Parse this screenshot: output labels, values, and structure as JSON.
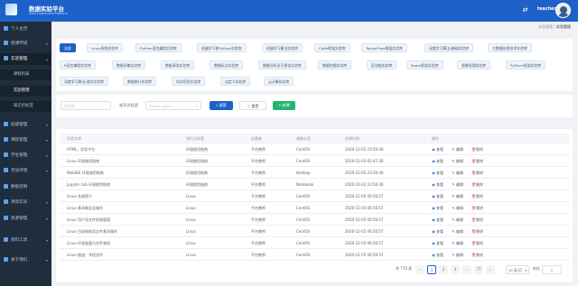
{
  "header": {
    "logo_icon": "platform-logo-icon",
    "title": "数据实验平台",
    "subtitle": "Data Experiment Platform",
    "user_name": "teacher",
    "icons": [
      "share-icon",
      "fullscreen-icon"
    ]
  },
  "sidebar": {
    "items": [
      {
        "label": "个人主页",
        "icon": "home-icon"
      },
      {
        "label": "授课环境",
        "icon": "desktop-icon"
      },
      {
        "label": "实验管理",
        "icon": "flask-icon"
      },
      {
        "label": "课程列表"
      },
      {
        "label": "实验管理"
      },
      {
        "label": "知识点标签"
      },
      {
        "label": "班级管理",
        "icon": "class-icon"
      },
      {
        "label": "课程管理",
        "icon": "book-icon"
      },
      {
        "label": "学生管理",
        "icon": "student-icon"
      },
      {
        "label": "考试评测",
        "icon": "exam-icon"
      },
      {
        "label": "数据控制",
        "icon": "data-icon"
      },
      {
        "label": "项目实训",
        "icon": "project-icon"
      },
      {
        "label": "资源管理",
        "icon": "resource-icon"
      },
      {
        "label": "资料工具",
        "icon": "tool-icon"
      },
      {
        "label": "关于我们",
        "icon": "info-icon"
      }
    ]
  },
  "breadcrumb": {
    "items": [
      "实验管理",
      "实验管理"
    ],
    "separator": "/"
  },
  "tags": {
    "items": [
      "全部",
      "Linux系统实验库",
      "Python语言编程实验库",
      "机器学习和Python实验库",
      "机器学习算法实验库",
      "Caffe框架实验库",
      "TensorFlow框架实验库",
      "深度学习算法/基础实验库",
      "大数据处理技术实验库",
      "R语言编程实验库",
      "数据采集实验库",
      "数据清洗实验库",
      "数据标注实验库",
      "数据分析及可视化实验库",
      "数据挖掘实验库",
      "区块链实验库",
      "Spark框架实验库",
      "图像处理实验库",
      "PyTorch框架实验库",
      "深度学习算法/进阶实验库",
      "数据统计实验库",
      "实训项目实验库",
      "自定义实验库",
      "云计算实验库"
    ]
  },
  "search": {
    "name_placeholder": "实验名",
    "knowledge_label": "知识点标签:",
    "select_placeholder": "Please select",
    "search_label": "搜索",
    "reset_label": "重置",
    "add_label": "+ 新增",
    "search_icon": "search-icon",
    "reset_icon": "refresh-icon"
  },
  "table": {
    "columns": [
      "实验名称",
      "知识点标签",
      "创建者",
      "镜像分类",
      "创建时间",
      "操作"
    ],
    "rows": [
      {
        "name": "HTML，实验平台",
        "tag": "环境使用指南",
        "creator": "平台教师",
        "image": "CentOS",
        "time": "2020-12-02 23:56:46"
      },
      {
        "name": "Linux 环境使用指南",
        "tag": "环境使用指南",
        "creator": "平台教师",
        "image": "CentOS",
        "time": "2020-12-03 02:47:28"
      },
      {
        "name": "WebIDE 环境使用指南",
        "tag": "环境使用指南",
        "creator": "平台教师",
        "image": "Hadoop",
        "time": "2020-12-02 23:56:46"
      },
      {
        "name": "Jupyter Lab 环境使用指南",
        "tag": "环境使用指南",
        "creator": "平台教师",
        "image": "Notebook",
        "time": "2020-12-02 23:56:46"
      },
      {
        "name": "Linux 系统简介",
        "tag": "Linux",
        "creator": "平台教师",
        "image": "CentOS",
        "time": "2020-12-05 06:56:57"
      },
      {
        "name": "Linux 基本概念及操作",
        "tag": "Linux",
        "creator": "平台教师",
        "image": "CentOS",
        "time": "2020-12-05 06:56:57"
      },
      {
        "name": "Linux 用户及文件权限管理",
        "tag": "Linux",
        "creator": "平台教师",
        "image": "CentOS",
        "time": "2020-12-05 06:56:57"
      },
      {
        "name": "Linux 目录结构及文件基本操作",
        "tag": "Linux",
        "creator": "平台教师",
        "image": "CentOS",
        "time": "2020-12-05 06:56:57"
      },
      {
        "name": "Linux 环境变量与文件查找",
        "tag": "Linux",
        "creator": "平台教师",
        "image": "CentOS",
        "time": "2020-12-05 06:56:57"
      },
      {
        "name": "Linux 挑战：寻找文件",
        "tag": "Linux",
        "creator": "平台教师",
        "image": "CentOS",
        "time": "2020-12-05 06:56:57"
      }
    ],
    "actions": {
      "view": "查看",
      "edit": "编辑",
      "delete": "删除",
      "view_icon": "eye-icon",
      "edit_icon": "edit-icon",
      "delete_icon": "trash-icon"
    }
  },
  "pagination": {
    "total": "共 770 条",
    "prev": "‹",
    "pages": [
      "1",
      "2",
      "3",
      "...",
      "77"
    ],
    "next": "›",
    "page_size": "10 条/页",
    "goto_label": "前往",
    "goto_value": "1"
  }
}
